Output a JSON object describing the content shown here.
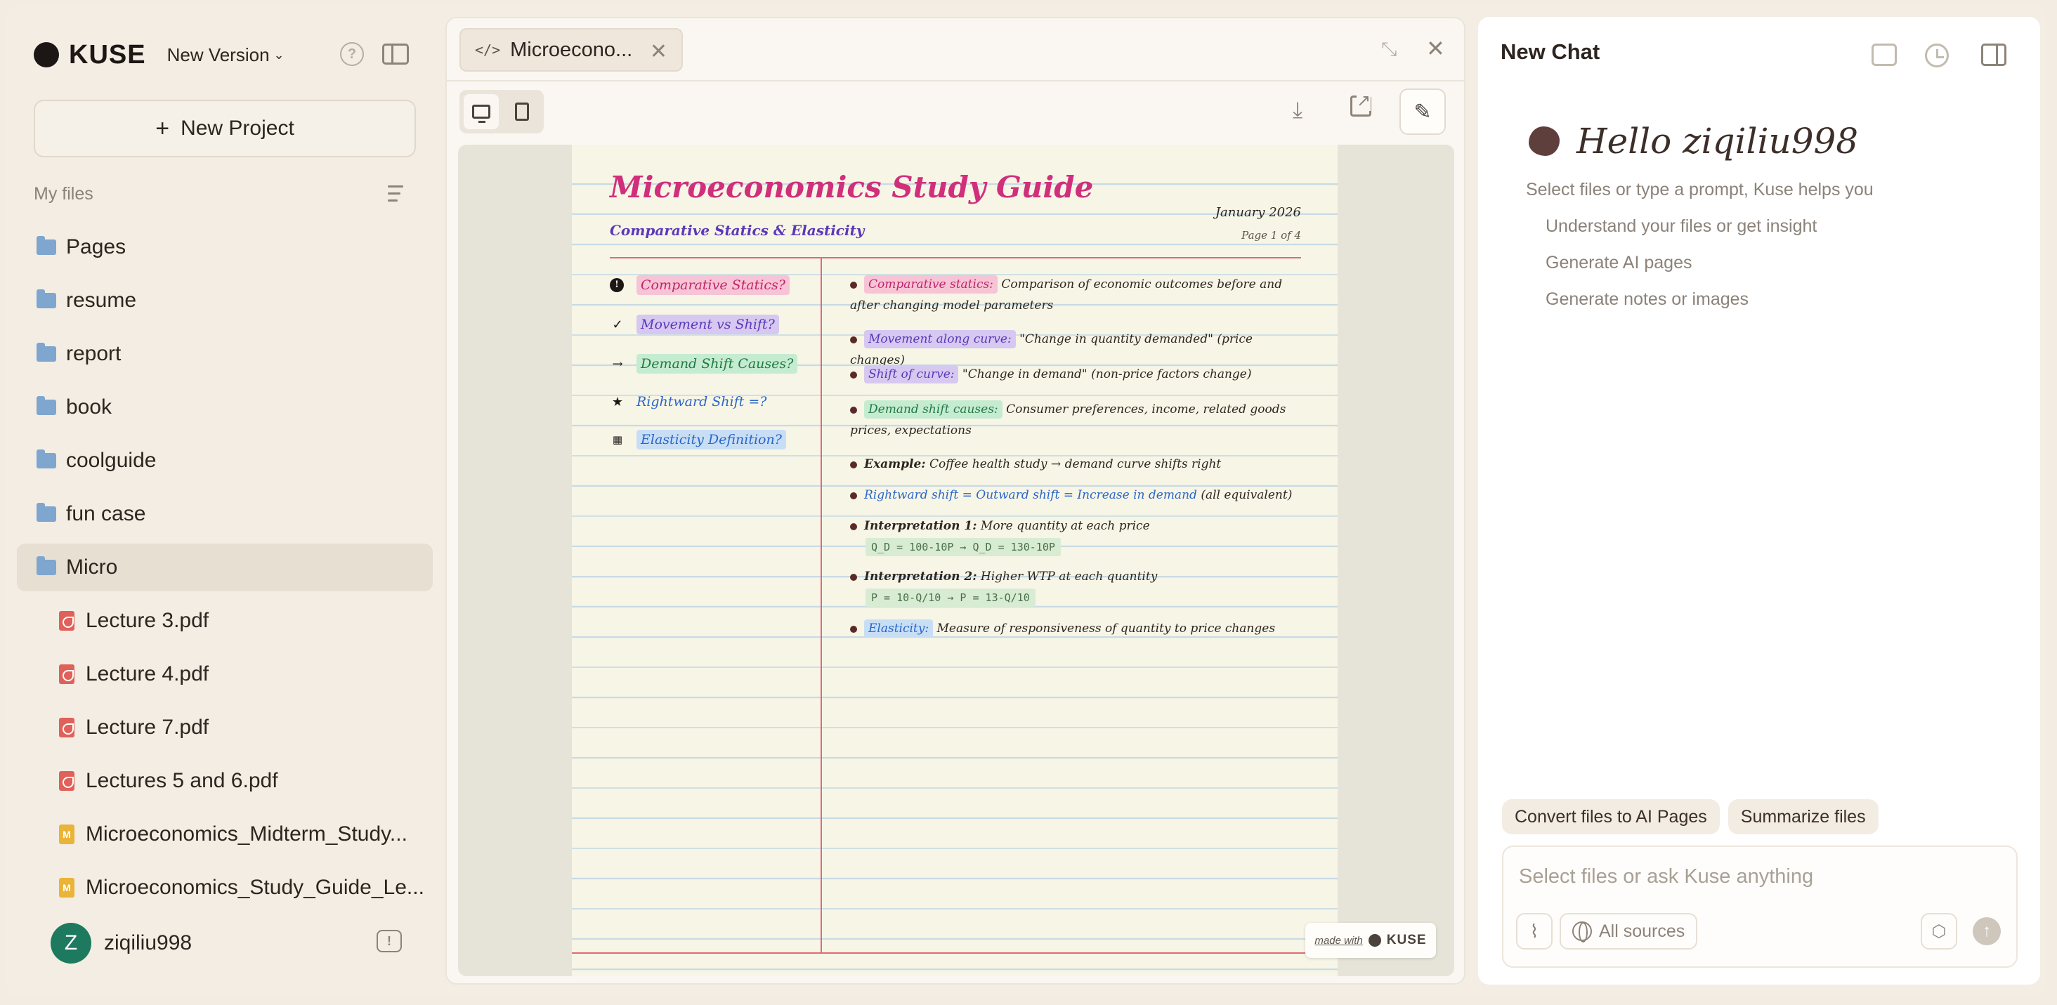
{
  "sidebar": {
    "logo": "KUSE",
    "version_label": "New Version",
    "new_project_label": "New Project",
    "my_files_label": "My files",
    "folders": [
      "Pages",
      "resume",
      "report",
      "book",
      "coolguide",
      "fun case",
      "Micro"
    ],
    "micro_files": [
      {
        "name": "Lecture 3.pdf",
        "icon": "pdf-icon"
      },
      {
        "name": "Lecture 4.pdf",
        "icon": "pdf-icon"
      },
      {
        "name": "Lecture 7.pdf",
        "icon": "pdf-icon"
      },
      {
        "name": "Lectures 5 and 6.pdf",
        "icon": "pdf-icon"
      },
      {
        "name": "Microeconomics_Midterm_Study...",
        "icon": "markdown-icon"
      },
      {
        "name": "Microeconomics_Study_Guide_Le...",
        "icon": "markdown-icon"
      }
    ],
    "user": {
      "initial": "Z",
      "name": "ziqiliu998"
    }
  },
  "preview": {
    "tab_label": "Microecono...",
    "page": {
      "title": "Microeconomics Study Guide",
      "subtitle": "Comparative Statics & Elasticity",
      "date": "January 2026",
      "page_number": "Page 1 of 4",
      "cues": [
        {
          "icon": "!",
          "text": "Comparative Statics?"
        },
        {
          "icon": "✓",
          "text": "Movement vs Shift?"
        },
        {
          "icon": "→",
          "text": "Demand Shift Causes?"
        },
        {
          "icon": "★",
          "text": "Rightward Shift =?"
        },
        {
          "icon": "📅",
          "text": "Elasticity Definition?"
        }
      ],
      "notes": {
        "n1_term": "Comparative statics:",
        "n1_text": "Comparison of economic outcomes before and after changing model parameters",
        "n2_term": "Movement along curve:",
        "n2_text": "\"Change in quantity demanded\" (price changes)",
        "n3_term": "Shift of curve:",
        "n3_text": "\"Change in demand\" (non-price factors change)",
        "n4_term": "Demand shift causes:",
        "n4_text": "Consumer preferences, income, related goods prices, expectations",
        "n5_label": "Example:",
        "n5_text": "Coffee health study → demand curve shifts right",
        "n6_blue": "Rightward shift = Outward shift = Increase in demand",
        "n6_text": "(all equivalent)",
        "n7_label": "Interpretation 1:",
        "n7_text": "More quantity at each price",
        "n7_formula": "Q_D = 100-10P → Q_D = 130-10P",
        "n8_label": "Interpretation 2:",
        "n8_text": "Higher WTP at each quantity",
        "n8_formula": "P = 10-Q/10 → P = 13-Q/10",
        "n9_term": "Elasticity:",
        "n9_text": "Measure of responsiveness of quantity to price changes"
      },
      "made_with": "made with",
      "made_with_logo": "KUSE"
    }
  },
  "chat": {
    "title": "New Chat",
    "greeting": "Hello ziqiliu998",
    "help_text": "Select files or type a prompt, Kuse helps you",
    "suggestions": [
      "Understand your files or get insight",
      "Generate AI pages",
      "Generate notes or images"
    ],
    "chips": [
      "Convert files to AI Pages",
      "Summarize files"
    ],
    "input_placeholder": "Select files or ask Kuse anything",
    "sources_label": "All sources"
  }
}
